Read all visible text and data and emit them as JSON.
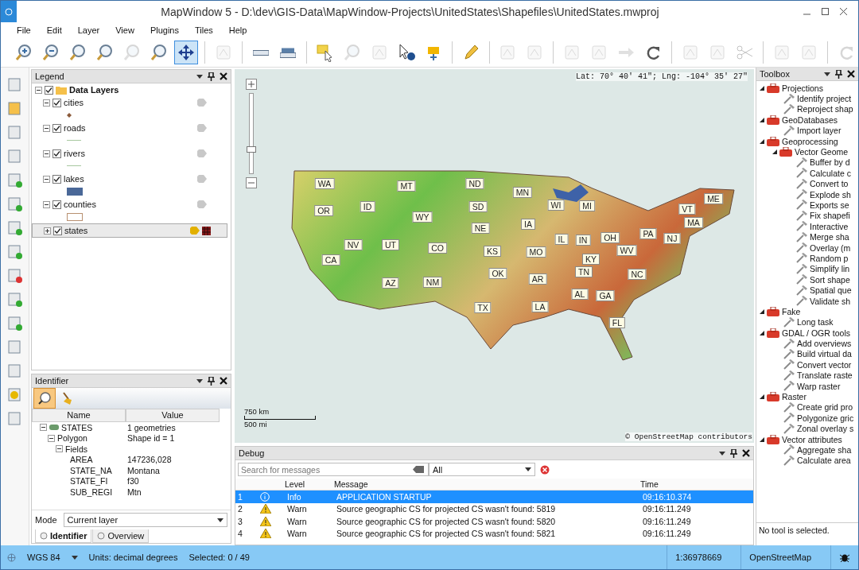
{
  "window": {
    "title": "MapWindow 5 - D:\\dev\\GIS-Data\\MapWindow-Projects\\UnitedStates\\Shapefiles\\UnitedStates.mwproj"
  },
  "menu": [
    "File",
    "Edit",
    "Layer",
    "View",
    "Plugins",
    "Tiles",
    "Help"
  ],
  "toolbar": [
    {
      "selected": false,
      "disabled": false
    },
    {
      "selected": false,
      "disabled": false
    },
    {
      "selected": false,
      "disabled": false
    },
    {
      "selected": false,
      "disabled": false
    },
    {
      "selected": false,
      "disabled": true
    },
    {
      "selected": false,
      "disabled": false
    },
    {
      "selected": true,
      "disabled": false
    },
    {
      "selected": false,
      "disabled": true
    },
    {
      "selected": false,
      "disabled": false
    },
    {
      "selected": false,
      "disabled": false
    },
    {
      "selected": false,
      "disabled": false
    },
    {
      "selected": false,
      "disabled": true
    },
    {
      "selected": false,
      "disabled": true
    },
    {
      "selected": false,
      "disabled": false
    },
    {
      "selected": false,
      "disabled": false
    },
    {
      "selected": false,
      "disabled": false
    },
    {
      "selected": false,
      "disabled": true
    },
    {
      "selected": false,
      "disabled": true
    },
    {
      "selected": false,
      "disabled": true
    },
    {
      "selected": false,
      "disabled": true
    },
    {
      "selected": false,
      "disabled": true
    },
    {
      "selected": false,
      "disabled": false
    },
    {
      "selected": false,
      "disabled": true
    },
    {
      "selected": false,
      "disabled": true
    },
    {
      "selected": false,
      "disabled": true
    },
    {
      "selected": false,
      "disabled": true
    },
    {
      "selected": false,
      "disabled": true
    },
    {
      "selected": false,
      "disabled": true
    }
  ],
  "legend": {
    "title": "Legend",
    "group": {
      "name": "Data Layers",
      "checked": true,
      "expanded": true
    },
    "layers": [
      {
        "name": "cities",
        "checked": true,
        "expanded": true,
        "selected": false,
        "labels_visible": false,
        "kind": "point"
      },
      {
        "name": "roads",
        "checked": true,
        "expanded": true,
        "selected": false,
        "labels_visible": false,
        "kind": "line"
      },
      {
        "name": "rivers",
        "checked": true,
        "expanded": true,
        "selected": false,
        "labels_visible": false,
        "kind": "line"
      },
      {
        "name": "lakes",
        "checked": true,
        "expanded": true,
        "selected": false,
        "labels_visible": false,
        "kind": "fill"
      },
      {
        "name": "counties",
        "checked": true,
        "expanded": true,
        "selected": false,
        "labels_visible": false,
        "kind": "outline"
      },
      {
        "name": "states",
        "checked": true,
        "expanded": false,
        "selected": true,
        "labels_visible": true
      }
    ]
  },
  "identifier": {
    "title": "Identifier",
    "columns": [
      "Name",
      "Value"
    ],
    "tree": [
      {
        "name": "STATES",
        "value": "1 geometries",
        "expanded": true,
        "children": [
          {
            "name": "Polygon",
            "value": "Shape id = 1",
            "expanded": true,
            "children": [
              {
                "name": "Fields",
                "expanded": true,
                "children": [
                  {
                    "name": "AREA",
                    "value": "147236,028"
                  },
                  {
                    "name": "STATE_NA",
                    "value": "Montana"
                  },
                  {
                    "name": "STATE_FI",
                    "value": "f30"
                  },
                  {
                    "name": "SUB_REGI",
                    "value": "Mtn"
                  }
                ]
              }
            ]
          }
        ]
      }
    ],
    "mode_label": "Mode",
    "mode": "Current layer",
    "tabs": [
      {
        "label": "Identifier",
        "selected": true
      },
      {
        "label": "Overview",
        "selected": false
      }
    ]
  },
  "map": {
    "coordinates": "Lat: 70° 40' 41\"; Lng: -104° 35' 27\"",
    "scale_km": "750 km",
    "scale_mi": "500 mi",
    "attribution": "© OpenStreetMap contributors",
    "level": 0.3,
    "states": [
      "WA",
      "MT",
      "ND",
      "MN",
      "ME",
      "OR",
      "ID",
      "WY",
      "SD",
      "WI",
      "MI",
      "VT",
      "MA",
      "NE",
      "IA",
      "IL",
      "IN",
      "OH",
      "PA",
      "NJ",
      "NV",
      "UT",
      "CO",
      "KS",
      "MO",
      "KY",
      "WV",
      "CA",
      "OK",
      "AR",
      "TN",
      "NC",
      "AZ",
      "NM",
      "AL",
      "GA",
      "TX",
      "LA",
      "FL"
    ]
  },
  "debug": {
    "title": "Debug",
    "search_placeholder": "Search for messages",
    "filter": "All",
    "columns": [
      "Level",
      "Message",
      "Time"
    ],
    "rows": [
      {
        "number": "1",
        "kind": "info",
        "level": "Info",
        "message": "APPLICATION STARTUP",
        "time": "09:16:10.374",
        "selected": true
      },
      {
        "number": "2",
        "kind": "warn",
        "level": "Warn",
        "message": "Source geographic CS for projected CS wasn't found: 5819",
        "time": "09:16:11.249",
        "selected": false
      },
      {
        "number": "3",
        "kind": "warn",
        "level": "Warn",
        "message": "Source geographic CS for projected CS wasn't found: 5820",
        "time": "09:16:11.249",
        "selected": false
      },
      {
        "number": "4",
        "kind": "warn",
        "level": "Warn",
        "message": "Source geographic CS for projected CS wasn't found: 5821",
        "time": "09:16:11.249",
        "selected": false
      }
    ]
  },
  "toolbox": {
    "title": "Toolbox",
    "status": "No tool is selected.",
    "tree": [
      {
        "name": "Projections",
        "expanded": true,
        "children": [
          {
            "name": "Identify project"
          },
          {
            "name": "Reproject shap"
          }
        ]
      },
      {
        "name": "GeoDatabases",
        "expanded": true,
        "children": [
          {
            "name": "Import layer"
          }
        ]
      },
      {
        "name": "Geoprocessing",
        "expanded": true,
        "children": [
          {
            "name": "Vector Geome",
            "expanded": true,
            "children": [
              {
                "name": "Buffer by d"
              },
              {
                "name": "Calculate c"
              },
              {
                "name": "Convert to"
              },
              {
                "name": "Explode sh"
              },
              {
                "name": "Exports se"
              },
              {
                "name": "Fix shapefi"
              },
              {
                "name": "Interactive"
              },
              {
                "name": "Merge sha"
              },
              {
                "name": "Overlay (m"
              },
              {
                "name": "Random p"
              },
              {
                "name": "Simplify lin"
              },
              {
                "name": "Sort shape"
              },
              {
                "name": "Spatial que"
              },
              {
                "name": "Validate sh"
              }
            ]
          }
        ]
      },
      {
        "name": "Fake",
        "expanded": true,
        "children": [
          {
            "name": "Long task"
          }
        ]
      },
      {
        "name": "GDAL / OGR tools",
        "expanded": true,
        "children": [
          {
            "name": "Add overviews"
          },
          {
            "name": "Build virtual da"
          },
          {
            "name": "Convert vector"
          },
          {
            "name": "Translate raste"
          },
          {
            "name": "Warp raster"
          }
        ]
      },
      {
        "name": "Raster",
        "expanded": true,
        "children": [
          {
            "name": "Create grid pro"
          },
          {
            "name": "Polygonize gric"
          },
          {
            "name": "Zonal overlay s"
          }
        ]
      },
      {
        "name": "Vector attributes",
        "expanded": true,
        "children": [
          {
            "name": "Aggregate sha"
          },
          {
            "name": "Calculate area"
          }
        ]
      }
    ]
  },
  "status_bar": {
    "projection": "WGS 84",
    "units": "Units: decimal degrees",
    "selected": "Selected: 0 / 49",
    "scale": "1:36978669",
    "tiles": "OpenStreetMap"
  }
}
